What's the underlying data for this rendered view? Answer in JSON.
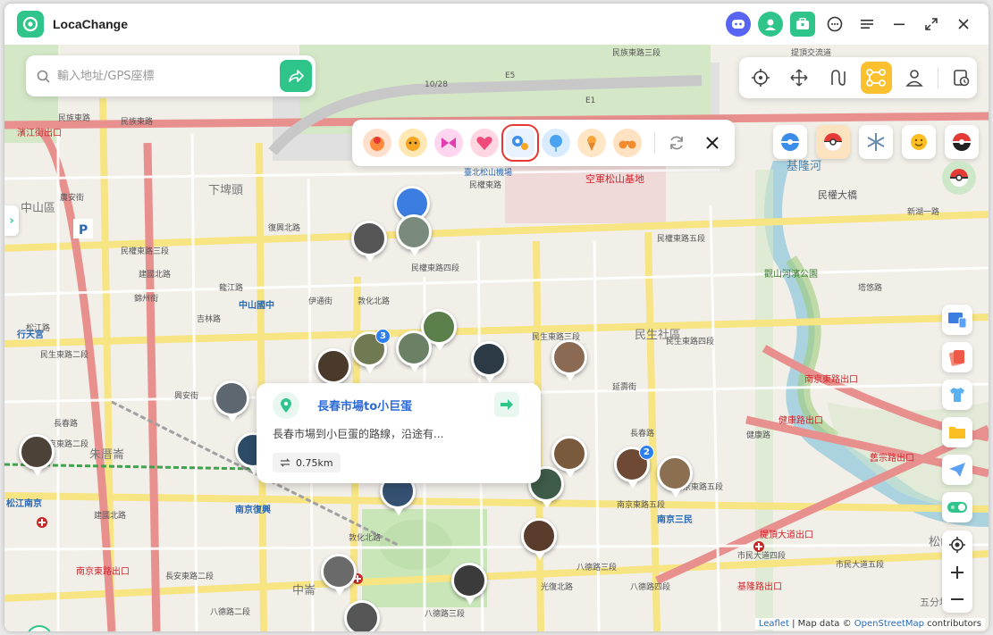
{
  "app": {
    "title": "LocaChange"
  },
  "search": {
    "placeholder": "輸入地址/GPS座標"
  },
  "popup": {
    "title": "長春市場to小巨蛋",
    "description": "長春市場到小巨蛋的路線，沿途有...",
    "distance": "0.75km"
  },
  "attribution": {
    "leaflet": "Leaflet",
    "sep": " | Map data © ",
    "osm": "OpenStreetMap",
    "suffix": " contributors"
  },
  "map_labels": {
    "streets": [
      "民族東路",
      "民族東路",
      "民族東路三段",
      "民權東路三段",
      "民權東路四段",
      "民權東路五段",
      "民生東路二段",
      "民生東路三段",
      "民生東路四段",
      "長春路",
      "長春路",
      "八德路二段",
      "八德路三段",
      "八德路三段",
      "南京東路二段",
      "南京東路五段",
      "南京東路五段",
      "市民大道四段",
      "市民大道五段",
      "松江路",
      "建國北路",
      "建國北路",
      "敦化北路",
      "敦化北路",
      "復興北路",
      "光復北路",
      "民權東路",
      "健康路",
      "興安街",
      "農安街",
      "龍江路",
      "錦州街",
      "吉林路",
      "伊通街",
      "長安東路二段",
      "八德路四段",
      "延壽街",
      "民權大橋",
      "新湖一路",
      "塔悠路",
      "提頂交流道",
      "10/28",
      "E1",
      "E5"
    ],
    "districts": [
      "中山區",
      "下埤頭",
      "民生社區",
      "朱厝崙",
      "中崙",
      "基隆河",
      "觀山河濱公園",
      "五分埔",
      "松山",
      "行天宮"
    ],
    "mrt": [
      "中山國中",
      "松江南京",
      "南京復興",
      "南京三民",
      "行天宮"
    ],
    "red": [
      "濱江街出口",
      "南京東路出口",
      "南京東路出口",
      "舊宗路出口",
      "健康路出口",
      "提頂大道出口",
      "基隆路出口",
      "空軍松山基地"
    ],
    "airport": [
      "臺北松山機場"
    ]
  },
  "pin_badges": [
    "3",
    "2"
  ],
  "colors": {
    "accent": "#2fc58a",
    "active_mode": "#fbc02d",
    "highlight_border": "#e53935",
    "link": "#2d6bd6"
  }
}
